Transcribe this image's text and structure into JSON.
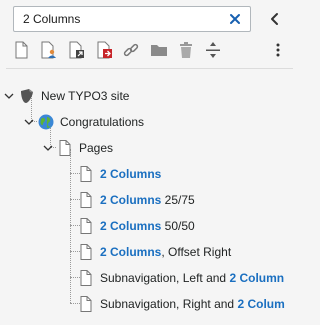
{
  "search": {
    "value": "2 Columns",
    "placeholder": ""
  },
  "toolbar": {
    "items": [
      {
        "icon": "new-page-icon"
      },
      {
        "icon": "new-page-with-user-icon"
      },
      {
        "icon": "new-shortcut-page-icon"
      },
      {
        "icon": "new-link-page-icon"
      },
      {
        "icon": "external-link-icon"
      },
      {
        "icon": "folder-icon"
      },
      {
        "icon": "recycler-icon"
      },
      {
        "icon": "spacer-icon"
      }
    ]
  },
  "tree": {
    "root": {
      "label": "New TYPO3 site"
    },
    "site": {
      "label": "Congratulations"
    },
    "folder": {
      "label": "Pages"
    },
    "children": [
      {
        "match": "2 Columns",
        "rest": ""
      },
      {
        "match": "2 Columns",
        "rest": " 25/75"
      },
      {
        "match": "2 Columns",
        "rest": " 50/50"
      },
      {
        "match": "2 Columns",
        "rest": ", Offset Right"
      },
      {
        "prefix": "Subnavigation, Left and ",
        "match": "2 Column"
      },
      {
        "prefix": "Subnavigation, Right and ",
        "match": "2 Colum"
      }
    ]
  },
  "colors": {
    "highlight": "#1a6fc0",
    "accent_red": "#c7252a",
    "clear_icon": "#1760b0"
  }
}
